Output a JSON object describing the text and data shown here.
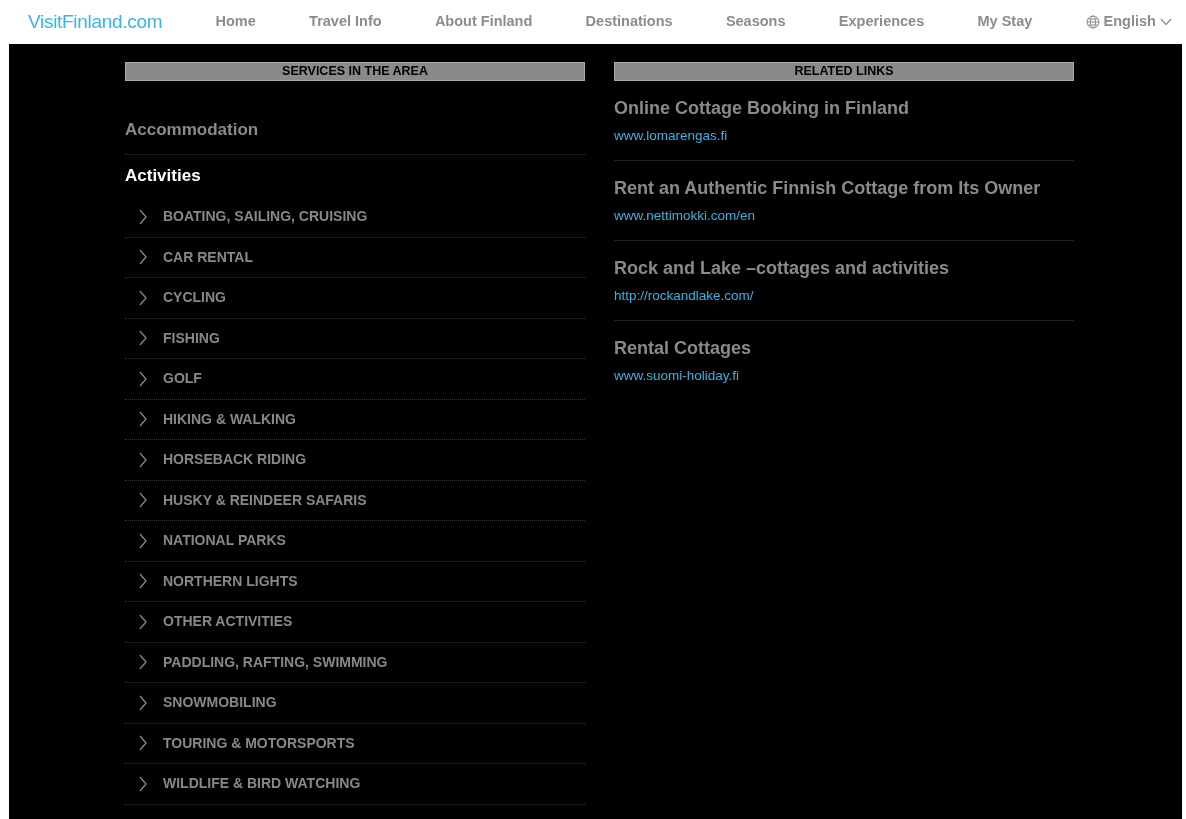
{
  "header": {
    "logo": "VisitFinland.com",
    "nav": [
      {
        "label": "Home"
      },
      {
        "label": "Travel Info"
      },
      {
        "label": "About Finland"
      },
      {
        "label": "Destinations"
      },
      {
        "label": "Seasons"
      },
      {
        "label": "Experiences"
      },
      {
        "label": "My Stay"
      }
    ],
    "language": "English"
  },
  "services": {
    "title": "SERVICES IN THE AREA",
    "categories": [
      {
        "label": "Accommodation",
        "expanded": false
      },
      {
        "label": "Activities",
        "expanded": true,
        "children": [
          {
            "label": "BOATING, SAILING, CRUISING"
          },
          {
            "label": "CAR RENTAL"
          },
          {
            "label": "CYCLING"
          },
          {
            "label": "FISHING"
          },
          {
            "label": "GOLF"
          },
          {
            "label": "HIKING & WALKING"
          },
          {
            "label": "HORSEBACK RIDING"
          },
          {
            "label": "HUSKY & REINDEER SAFARIS"
          },
          {
            "label": "NATIONAL PARKS"
          },
          {
            "label": "NORTHERN LIGHTS"
          },
          {
            "label": "OTHER ACTIVITIES"
          },
          {
            "label": "PADDLING, RAFTING, SWIMMING"
          },
          {
            "label": "SNOWMOBILING"
          },
          {
            "label": "TOURING & MOTORSPORTS"
          },
          {
            "label": "WILDLIFE & BIRD WATCHING"
          }
        ]
      }
    ]
  },
  "related_links": {
    "title": "RELATED LINKS",
    "links": [
      {
        "title": "Online Cottage Booking in Finland",
        "url": "www.lomarengas.fi"
      },
      {
        "title": "Rent an Authentic Finnish Cottage from Its Owner",
        "url": "www.nettimokki.com/en"
      },
      {
        "title": "Rock and Lake –cottages and activities",
        "url": "http://rockandlake.com/"
      },
      {
        "title": "Rental Cottages",
        "url": "www.suomi-holiday.fi"
      }
    ]
  }
}
